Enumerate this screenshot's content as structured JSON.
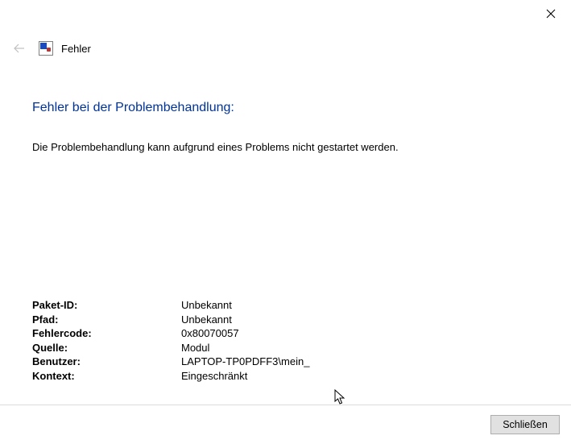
{
  "window": {
    "title": "Fehler"
  },
  "main": {
    "heading": "Fehler bei der Problembehandlung:",
    "description": "Die Problembehandlung kann aufgrund eines Problems nicht gestartet werden."
  },
  "details": {
    "rows": [
      {
        "label": "Paket-ID:",
        "value": "Unbekannt"
      },
      {
        "label": "Pfad:",
        "value": "Unbekannt"
      },
      {
        "label": "Fehlercode:",
        "value": "0x80070057"
      },
      {
        "label": "Quelle:",
        "value": "Modul"
      },
      {
        "label": "Benutzer:",
        "value": "LAPTOP-TP0PDFF3\\mein_"
      },
      {
        "label": "Kontext:",
        "value": "Eingeschränkt"
      }
    ]
  },
  "footer": {
    "close_label": "Schließen"
  }
}
